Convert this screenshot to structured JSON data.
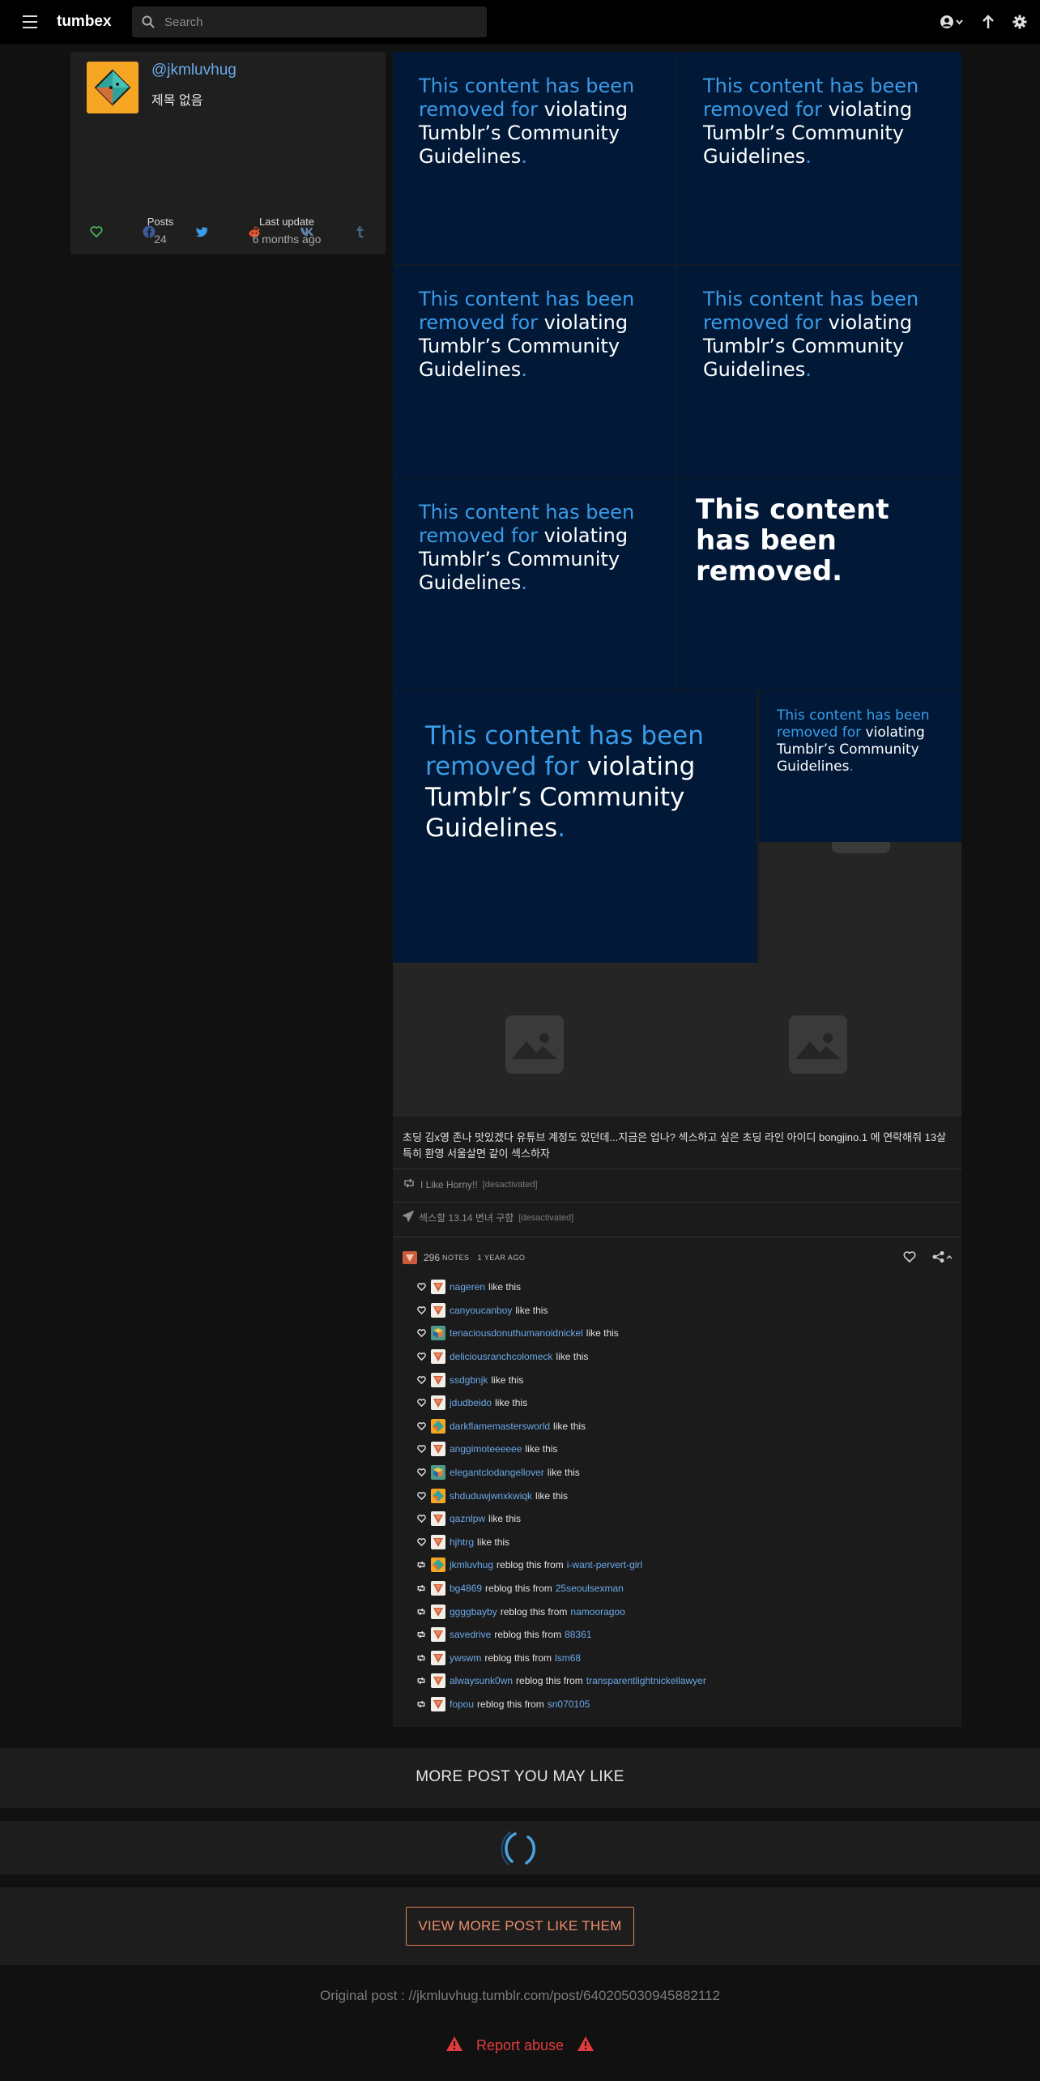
{
  "topbar": {
    "brand": "tumbex",
    "search_placeholder": "Search"
  },
  "blog": {
    "name": "@jkmluvhug",
    "title": "제목 없음",
    "stats": {
      "posts_label": "Posts",
      "posts_value": "24",
      "update_label": "Last update",
      "update_value": "6 months ago"
    }
  },
  "removed_notice": {
    "part1": "This content has been removed for",
    "part2": "violating Tumblr’s Community Guidelines",
    "dot": ".",
    "short": "This content has been removed."
  },
  "post": {
    "caption": "초딩 김x영 존나 맛있겠다 유튜브 계정도 있던데...지금은 업나? 섹스하고 싶은 초딩 라인 아이디 bongjino.1 에 연락해줘 13살 특히 환영 서울살면 같이 섹스하자",
    "reblog_from": "I Like Horny!!",
    "reblog_from_status": "[desactivated]",
    "source": "섹스할 13.14 변녀 구함",
    "source_status": "[desactivated]",
    "notes_count": "296",
    "notes_label": "NOTES",
    "time_ago": "1 YEAR AGO"
  },
  "notes": [
    {
      "type": "like",
      "user": "nageren",
      "text": "like this",
      "avatar": "triangle"
    },
    {
      "type": "like",
      "user": "canyoucanboy",
      "text": "like this",
      "avatar": "triangle"
    },
    {
      "type": "like",
      "user": "tenaciousdonuthumanoidnickel",
      "text": "like this",
      "avatar": "cube"
    },
    {
      "type": "like",
      "user": "deliciousranchcolomeck",
      "text": "like this",
      "avatar": "triangle"
    },
    {
      "type": "like",
      "user": "ssdgbnjk",
      "text": "like this",
      "avatar": "triangle"
    },
    {
      "type": "like",
      "user": "jdudbeido",
      "text": "like this",
      "avatar": "triangle"
    },
    {
      "type": "like",
      "user": "darkflamemastersworld",
      "text": "like this",
      "avatar": "diamond"
    },
    {
      "type": "like",
      "user": "anggimoteeeeee",
      "text": "like this",
      "avatar": "triangle"
    },
    {
      "type": "like",
      "user": "elegantclodangellover",
      "text": "like this",
      "avatar": "cube"
    },
    {
      "type": "like",
      "user": "shduduwjwnxkwiqk",
      "text": "like this",
      "avatar": "diamond"
    },
    {
      "type": "like",
      "user": "qaznlpw",
      "text": "like this",
      "avatar": "triangle"
    },
    {
      "type": "like",
      "user": "hjhtrg",
      "text": "like this",
      "avatar": "triangle"
    },
    {
      "type": "reblog",
      "user": "jkmluvhug",
      "text": "reblog this from",
      "from": "i-want-pervert-girl",
      "avatar": "diamond"
    },
    {
      "type": "reblog",
      "user": "bg4869",
      "text": "reblog this from",
      "from": "25seoulsexman",
      "avatar": "triangle"
    },
    {
      "type": "reblog",
      "user": "ggggbayby",
      "text": "reblog this from",
      "from": "namooragoo",
      "avatar": "triangle"
    },
    {
      "type": "reblog",
      "user": "savedrive",
      "text": "reblog this from",
      "from": "88361",
      "avatar": "triangle"
    },
    {
      "type": "reblog",
      "user": "ywswm",
      "text": "reblog this from",
      "from": "lsm68",
      "avatar": "triangle"
    },
    {
      "type": "reblog",
      "user": "alwaysunk0wn",
      "text": "reblog this from",
      "from": "transparentlightnickellawyer",
      "avatar": "triangle"
    },
    {
      "type": "reblog",
      "user": "fopou",
      "text": "reblog this from",
      "from": "sn070105",
      "avatar": "triangle"
    }
  ],
  "footer": {
    "more_title": "MORE POST YOU MAY LIKE",
    "view_more": "VIEW MORE POST LIKE THEM",
    "original_post": "Original post : //jkmluvhug.tumblr.com/post/640205030945882112",
    "report": "Report abuse"
  },
  "colors": {
    "accent_blue": "#3a9be8",
    "link": "#6aa9e9",
    "tile_bg": "#011937",
    "report_red": "#e23b3b",
    "button_orange": "#e77c59"
  }
}
